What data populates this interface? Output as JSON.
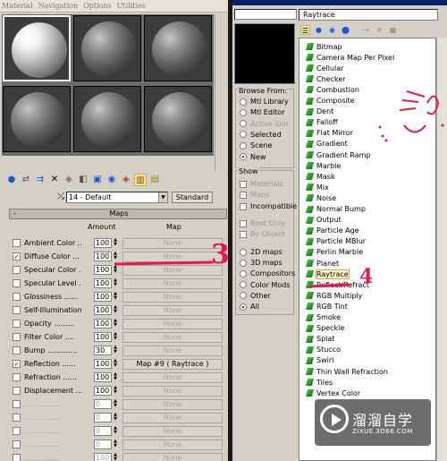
{
  "menu": [
    "Material",
    "Navigation",
    "Options",
    "Utilities"
  ],
  "material_name": "14 - Default",
  "material_type_button": "Standard",
  "maps_rollout": {
    "toggle": "-",
    "title": "Maps",
    "col_amount": "Amount",
    "col_map": "Map",
    "rows": [
      {
        "label": "Ambient Color ..",
        "checked": false,
        "amount": "100",
        "map": "None"
      },
      {
        "label": "Diffuse Color ...",
        "checked": true,
        "amount": "100",
        "map": "None"
      },
      {
        "label": "Specular Color ..",
        "checked": false,
        "amount": "100",
        "map": "None"
      },
      {
        "label": "Specular Level ..",
        "checked": false,
        "amount": "100",
        "map": "None"
      },
      {
        "label": "Glossiness ......",
        "checked": false,
        "amount": "100",
        "map": "None"
      },
      {
        "label": "Self-Illumination .",
        "checked": false,
        "amount": "100",
        "map": "None"
      },
      {
        "label": "Opacity .........",
        "checked": false,
        "amount": "100",
        "map": "None"
      },
      {
        "label": "Filter Color ....",
        "checked": false,
        "amount": "100",
        "map": "None"
      },
      {
        "label": "Bump .............",
        "checked": false,
        "amount": "30",
        "map": "None"
      },
      {
        "label": "Reflection ......",
        "checked": true,
        "amount": "100",
        "map": "Map #9  ( Raytrace )"
      },
      {
        "label": "Refraction ......",
        "checked": false,
        "amount": "100",
        "map": "None"
      },
      {
        "label": "Displacement .....",
        "checked": false,
        "amount": "100",
        "map": "None"
      },
      {
        "label": "................",
        "checked": false,
        "amount": "0",
        "map": "None",
        "dim": true
      },
      {
        "label": "................",
        "checked": false,
        "amount": "0",
        "map": "None",
        "dim": true
      },
      {
        "label": "................",
        "checked": false,
        "amount": "0",
        "map": "None",
        "dim": true
      },
      {
        "label": "................",
        "checked": false,
        "amount": "0",
        "map": "None",
        "dim": true
      },
      {
        "label": "................",
        "checked": false,
        "amount": "100",
        "map": "None",
        "dim": true
      }
    ]
  },
  "browser": {
    "selected_name": "Raytrace",
    "browse_from": {
      "title": "Browse From:",
      "options": [
        {
          "label": "Mtl Library",
          "on": false,
          "dim": false
        },
        {
          "label": "Mtl Editor",
          "on": false,
          "dim": false
        },
        {
          "label": "Active Slot",
          "on": false,
          "dim": true
        },
        {
          "label": "Selected",
          "on": false,
          "dim": false
        },
        {
          "label": "Scene",
          "on": false,
          "dim": false
        },
        {
          "label": "New",
          "on": true,
          "dim": false
        }
      ]
    },
    "show": {
      "title": "Show",
      "checks": [
        {
          "label": "Materials",
          "checked": false,
          "dim": true
        },
        {
          "label": "Maps",
          "checked": true,
          "dim": true
        },
        {
          "label": "Incompatible",
          "checked": false,
          "dim": false
        },
        {
          "label": "Root Only",
          "checked": false,
          "dim": true
        },
        {
          "label": "By Object",
          "checked": false,
          "dim": true
        }
      ],
      "radios": [
        {
          "label": "2D maps",
          "on": false
        },
        {
          "label": "3D maps",
          "on": false
        },
        {
          "label": "Compositors",
          "on": false
        },
        {
          "label": "Color Mods",
          "on": false
        },
        {
          "label": "Other",
          "on": false
        },
        {
          "label": "All",
          "on": true
        }
      ]
    },
    "map_types": [
      "Bitmap",
      "Camera Map Per Pixel",
      "Cellular",
      "Checker",
      "Combustion",
      "Composite",
      "Dent",
      "Falloff",
      "Flat Mirror",
      "Gradient",
      "Gradient Ramp",
      "Marble",
      "Mask",
      "Mix",
      "Noise",
      "Normal Bump",
      "Output",
      "Particle Age",
      "Particle MBlur",
      "Perlin Marble",
      "Planet",
      "Raytrace",
      "Reflect/Refract",
      "RGB Multiply",
      "RGB Tint",
      "Smoke",
      "Speckle",
      "Splat",
      "Stucco",
      "Swirl",
      "Thin Wall Refraction",
      "Tiles",
      "Vertex Color"
    ],
    "selected_index": 21
  },
  "annotations": {
    "step3": "3",
    "step4": "4"
  },
  "watermark": {
    "cn": "溜溜自学",
    "en": "ZIXUE.3D66.COM"
  },
  "colors": {
    "annotation": "#e8194c",
    "highlight": "#fffac8",
    "bg": "#d4d0c8"
  }
}
